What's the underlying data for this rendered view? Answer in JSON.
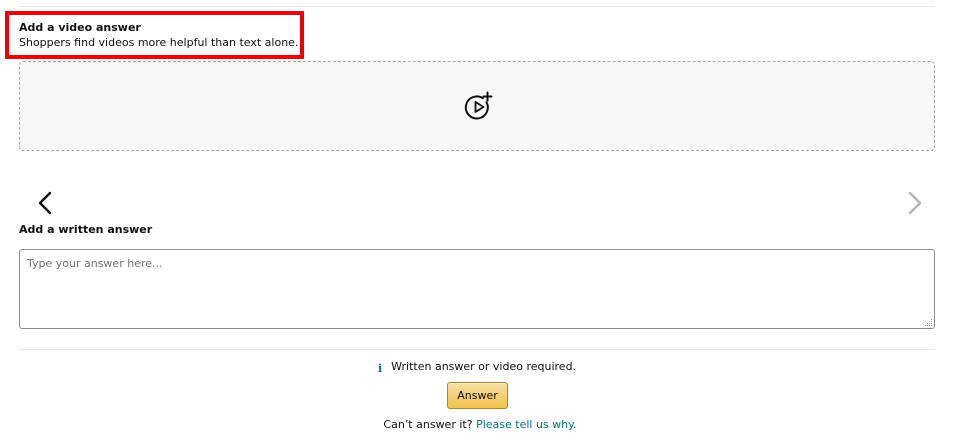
{
  "video_section": {
    "title": "Add a video answer",
    "subtitle": "Shoppers find videos more helpful than text alone.",
    "upload_icon": "video-add-icon"
  },
  "carousel": {
    "prev_icon": "chevron-left-icon",
    "next_icon": "chevron-right-icon"
  },
  "written_section": {
    "title": "Add a written answer",
    "placeholder": "Type your answer here...",
    "value": ""
  },
  "requirement": {
    "icon": "info-icon",
    "icon_glyph": "i",
    "text": "Written answer or video required."
  },
  "actions": {
    "answer_label": "Answer"
  },
  "footer": {
    "prefix": "Can’t answer it?",
    "link_text": "Please tell us why."
  },
  "colors": {
    "highlight_border": "#ee0000",
    "link": "#007185",
    "button_gradient_top": "#f7dfa5",
    "button_gradient_bottom": "#f0c14b"
  }
}
